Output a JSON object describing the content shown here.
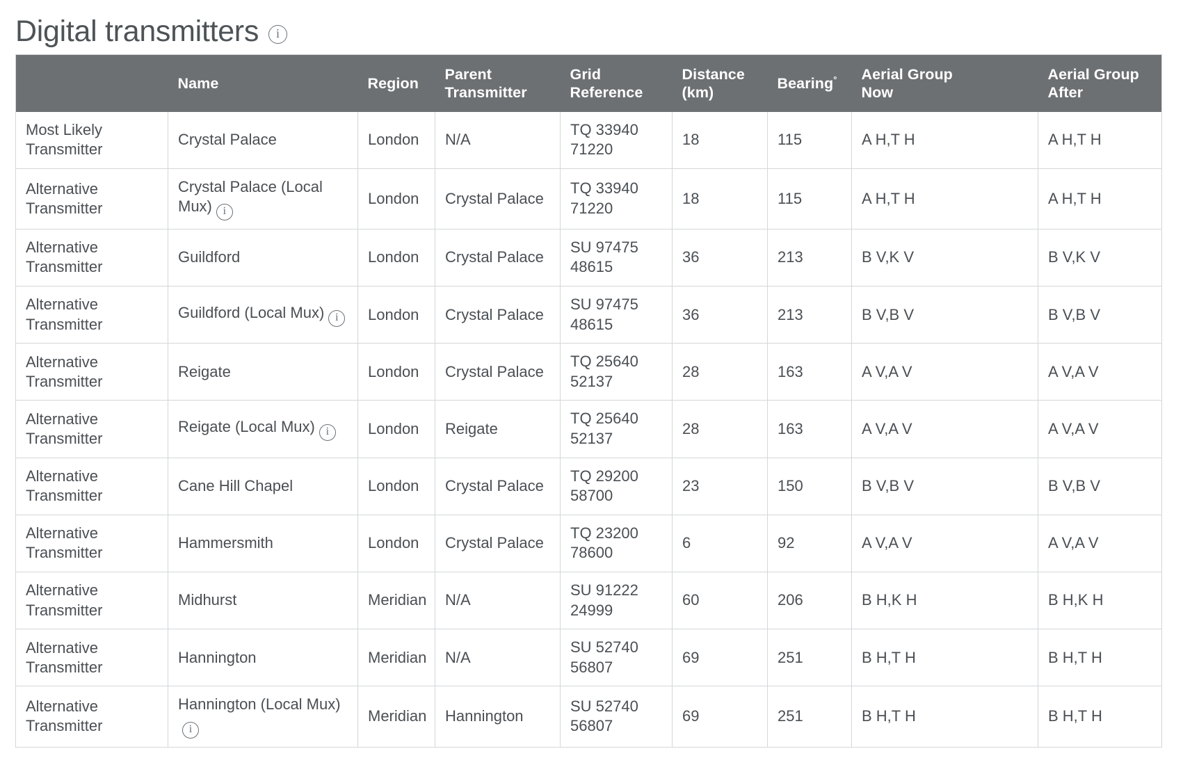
{
  "heading": {
    "title": "Digital transmitters",
    "info_icon": "info-icon",
    "info_glyph": "i"
  },
  "colors": {
    "header_background": "#6d7073",
    "header_text": "#ffffff",
    "body_text": "#4a4f54",
    "border": "#d4d6d8",
    "page_background": "#ffffff"
  },
  "table": {
    "columns": [
      {
        "key": "kind",
        "label": ""
      },
      {
        "key": "name",
        "label": "Name"
      },
      {
        "key": "region",
        "label": "Region"
      },
      {
        "key": "parent",
        "label": "Parent Transmitter",
        "line1": "Parent",
        "line2": "Transmitter"
      },
      {
        "key": "grid",
        "label": "Grid Reference",
        "line1": "Grid",
        "line2": "Reference"
      },
      {
        "key": "dist",
        "label": "Distance (km)",
        "line1": "Distance",
        "line2": "(km)"
      },
      {
        "key": "bear",
        "label": "Bearing°",
        "base": "Bearing",
        "sup": "°"
      },
      {
        "key": "agn",
        "label": "Aerial Group Now",
        "line1": "Aerial Group",
        "line2": "Now"
      },
      {
        "key": "aga",
        "label": "Aerial Group After",
        "line1": "Aerial Group",
        "line2": "After"
      }
    ],
    "rows": [
      {
        "kind_line1": "Most Likely",
        "kind_line2": "Transmitter",
        "name": "Crystal Palace",
        "name_info": false,
        "region": "London",
        "parent": "N/A",
        "grid_line1": "TQ 33940",
        "grid_line2": "71220",
        "distance_km": "18",
        "bearing": "115",
        "aerial_now": "A H,T H",
        "aerial_after": "A H,T H"
      },
      {
        "kind_line1": "Alternative",
        "kind_line2": "Transmitter",
        "name": "Crystal Palace (Local Mux)",
        "name_info": true,
        "region": "London",
        "parent": "Crystal Palace",
        "grid_line1": "TQ 33940",
        "grid_line2": "71220",
        "distance_km": "18",
        "bearing": "115",
        "aerial_now": "A H,T H",
        "aerial_after": "A H,T H"
      },
      {
        "kind_line1": "Alternative",
        "kind_line2": "Transmitter",
        "name": "Guildford",
        "name_info": false,
        "region": "London",
        "parent": "Crystal Palace",
        "grid_line1": "SU 97475",
        "grid_line2": "48615",
        "distance_km": "36",
        "bearing": "213",
        "aerial_now": "B V,K V",
        "aerial_after": "B V,K V"
      },
      {
        "kind_line1": "Alternative",
        "kind_line2": "Transmitter",
        "name": "Guildford (Local Mux)",
        "name_info": true,
        "region": "London",
        "parent": "Crystal Palace",
        "grid_line1": "SU 97475",
        "grid_line2": "48615",
        "distance_km": "36",
        "bearing": "213",
        "aerial_now": "B V,B V",
        "aerial_after": "B V,B V"
      },
      {
        "kind_line1": "Alternative",
        "kind_line2": "Transmitter",
        "name": "Reigate",
        "name_info": false,
        "region": "London",
        "parent": "Crystal Palace",
        "grid_line1": "TQ 25640",
        "grid_line2": "52137",
        "distance_km": "28",
        "bearing": "163",
        "aerial_now": "A V,A V",
        "aerial_after": "A V,A V"
      },
      {
        "kind_line1": "Alternative",
        "kind_line2": "Transmitter",
        "name": "Reigate (Local Mux)",
        "name_info": true,
        "region": "London",
        "parent": "Reigate",
        "grid_line1": "TQ 25640",
        "grid_line2": "52137",
        "distance_km": "28",
        "bearing": "163",
        "aerial_now": "A V,A V",
        "aerial_after": "A V,A V"
      },
      {
        "kind_line1": "Alternative",
        "kind_line2": "Transmitter",
        "name": "Cane Hill Chapel",
        "name_info": false,
        "region": "London",
        "parent": "Crystal Palace",
        "grid_line1": "TQ 29200",
        "grid_line2": "58700",
        "distance_km": "23",
        "bearing": "150",
        "aerial_now": "B V,B V",
        "aerial_after": "B V,B V"
      },
      {
        "kind_line1": "Alternative",
        "kind_line2": "Transmitter",
        "name": "Hammersmith",
        "name_info": false,
        "region": "London",
        "parent": "Crystal Palace",
        "grid_line1": "TQ 23200",
        "grid_line2": "78600",
        "distance_km": "6",
        "bearing": "92",
        "aerial_now": "A V,A V",
        "aerial_after": "A V,A V"
      },
      {
        "kind_line1": "Alternative",
        "kind_line2": "Transmitter",
        "name": "Midhurst",
        "name_info": false,
        "region": "Meridian",
        "parent": "N/A",
        "grid_line1": "SU 91222",
        "grid_line2": "24999",
        "distance_km": "60",
        "bearing": "206",
        "aerial_now": "B H,K H",
        "aerial_after": "B H,K H"
      },
      {
        "kind_line1": "Alternative",
        "kind_line2": "Transmitter",
        "name": "Hannington",
        "name_info": false,
        "region": "Meridian",
        "parent": "N/A",
        "grid_line1": "SU 52740",
        "grid_line2": "56807",
        "distance_km": "69",
        "bearing": "251",
        "aerial_now": "B H,T H",
        "aerial_after": "B H,T H"
      },
      {
        "kind_line1": "Alternative",
        "kind_line2": "Transmitter",
        "name": "Hannington (Local Mux)",
        "name_info": true,
        "region": "Meridian",
        "parent": "Hannington",
        "grid_line1": "SU 52740",
        "grid_line2": "56807",
        "distance_km": "69",
        "bearing": "251",
        "aerial_now": "B H,T H",
        "aerial_after": "B H,T H"
      }
    ]
  }
}
